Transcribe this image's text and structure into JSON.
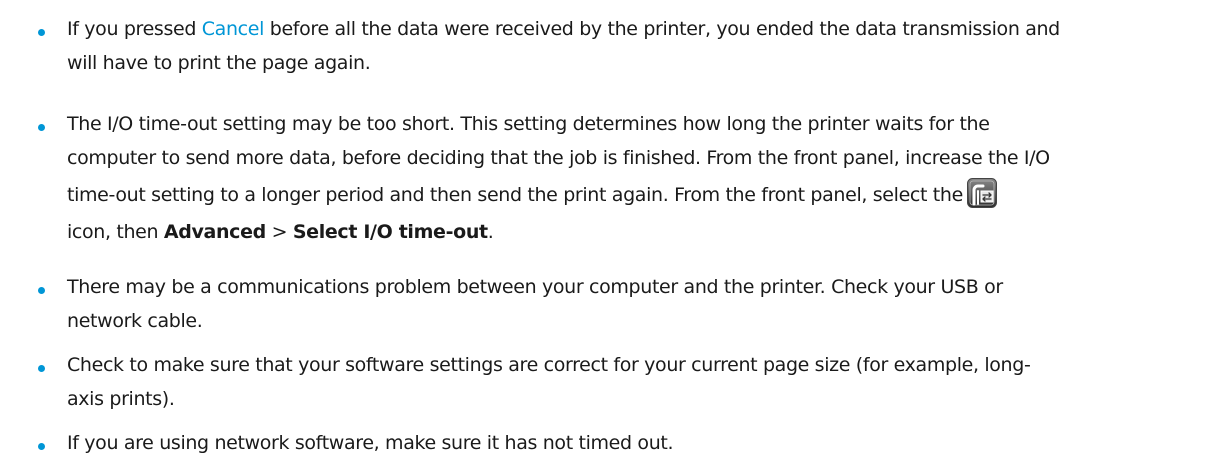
{
  "bullets": [
    {
      "lines": [
        {
          "before": "If you pressed ",
          "link": "Cancel",
          "after": " before all the data were received by the printer, you ended the data transmission and"
        },
        {
          "text": "will have to print the page again."
        }
      ]
    },
    {
      "lines": [
        {
          "text": "The I/O time-out setting may be too short. This setting determines how long the printer waits for the"
        },
        {
          "text": "computer to send more data, before deciding that the job is finished. From the front panel, increase the I/O"
        },
        {
          "text": "time-out setting to a longer period and then send the print again. From the front panel, select the"
        },
        {
          "before": "icon, then ",
          "bold1": "Advanced",
          "sep": " > ",
          "bold2": "Select I/O time-out",
          "after": "."
        }
      ],
      "icon": "connectivity-settings-icon"
    },
    {
      "lines": [
        {
          "text": "There may be a communications problem between your computer and the printer. Check your USB or"
        },
        {
          "text": "network cable."
        }
      ]
    },
    {
      "lines": [
        {
          "text": "Check to make sure that your software settings are correct for your current page size (for example, long-"
        },
        {
          "text": "axis prints)."
        }
      ]
    },
    {
      "lines": [
        {
          "text": "If you are using network software, make sure it has not timed out."
        }
      ]
    }
  ],
  "colors": {
    "bullet": "#0096d6",
    "link": "#0096d6",
    "text": "#1a1a1a"
  }
}
